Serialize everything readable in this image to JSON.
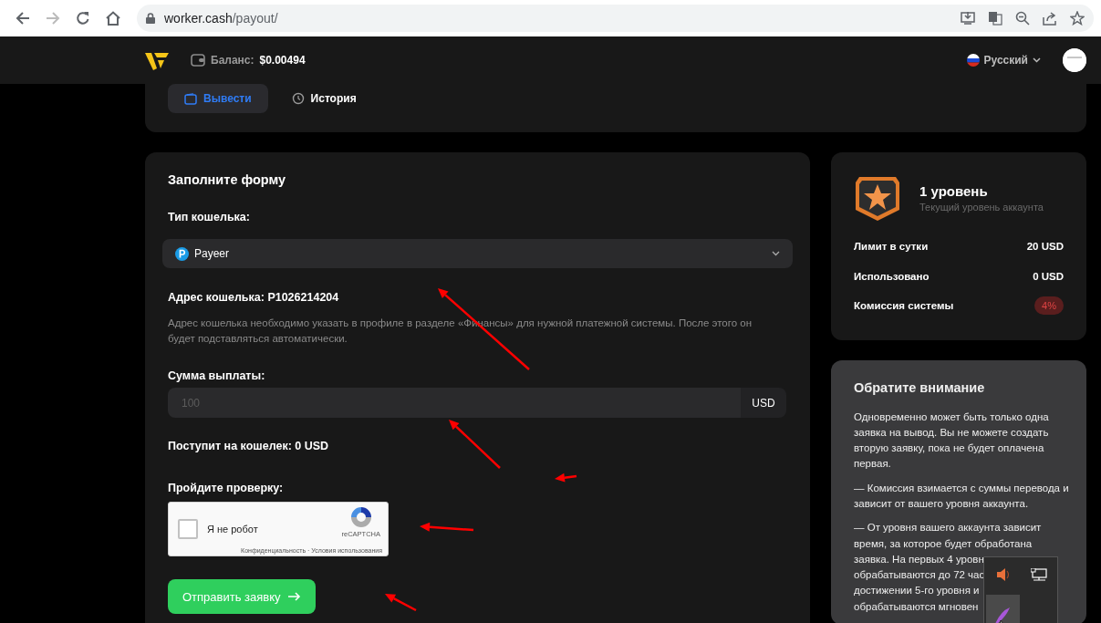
{
  "browser": {
    "url_host": "worker.cash",
    "url_path": "/payout/"
  },
  "header": {
    "balance_label": "Баланс:",
    "balance": "$0.00494",
    "language": "Русский"
  },
  "tabs": [
    {
      "label": "Вывести",
      "kind": "wallet",
      "selected": true
    },
    {
      "label": "История",
      "kind": "history",
      "selected": false
    }
  ],
  "form": {
    "title": "Заполните форму",
    "wallet_type_label": "Тип кошелька:",
    "wallet_type": "Payeer",
    "address_label": "Адрес кошелька: P1026214204",
    "address_hint": "Адрес кошелька необходимо указать в профиле в разделе «Финансы» для нужной платежной системы. После этого он будет подставляться автоматически.",
    "amount_label": "Сумма выплаты:",
    "amount_placeholder": "100",
    "amount_currency": "USD",
    "receive_label": "Поступит на кошелек: 0 USD",
    "verify_label": "Пройдите проверку:",
    "captcha": {
      "label": "Я не робот",
      "checked": false,
      "brand": "reCAPTCHA",
      "links": "Конфиденциальность · Условия использования"
    },
    "submit": "Отправить заявку"
  },
  "level": {
    "title": "1 уровень",
    "subtitle": "Текущий уровень аккаунта",
    "rows": [
      {
        "label": "Лимит в сутки",
        "value": "20 USD",
        "kind": "text"
      },
      {
        "label": "Использовано",
        "value": "0 USD",
        "kind": "text"
      },
      {
        "label": "Комиссия системы",
        "value": "4%",
        "kind": "badge"
      }
    ]
  },
  "notice": {
    "title": "Обратите внимание",
    "paragraphs": [
      "Одновременно может быть только одна заявка на вывод. Вы не можете создать вторую заявку, пока не будет оплачена первая.",
      "— Комиссия взимается с суммы перевода и зависит от вашего уровня аккаунта."
    ],
    "last_paragraph_lines": [
      "— От уровня вашего аккаунта зависит",
      "время, за которое будет обработана",
      "заявка. На первых 4 уровн",
      "обрабатываются до 72 час",
      "достижении 5-го уровня и",
      "обрабатываются мгновен"
    ]
  }
}
